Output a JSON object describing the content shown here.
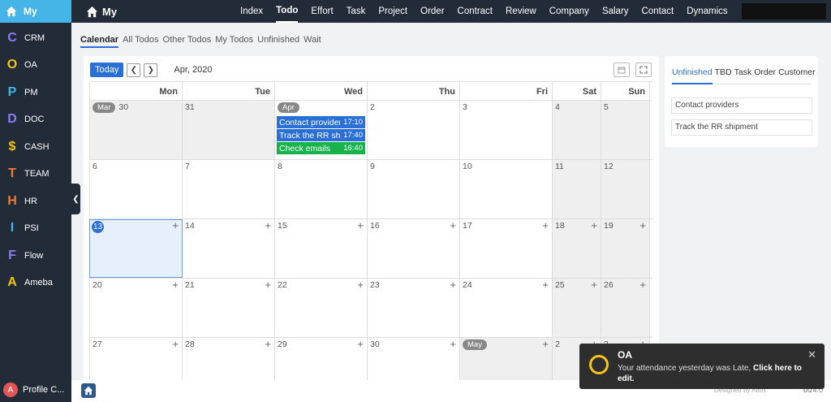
{
  "sidebar": {
    "home_label": "My",
    "items": [
      {
        "letter": "C",
        "label": "CRM",
        "color": "#8b7cf6"
      },
      {
        "letter": "O",
        "label": "OA",
        "color": "#f5c518"
      },
      {
        "letter": "P",
        "label": "PM",
        "color": "#45b5e8"
      },
      {
        "letter": "D",
        "label": "DOC",
        "color": "#8b7cf6"
      },
      {
        "letter": "$",
        "label": "CASH",
        "color": "#f5c518"
      },
      {
        "letter": "T",
        "label": "TEAM",
        "color": "#f07a3a"
      },
      {
        "letter": "H",
        "label": "HR",
        "color": "#f07a3a"
      },
      {
        "letter": "I",
        "label": "PSI",
        "color": "#45b5e8"
      },
      {
        "letter": "F",
        "label": "Flow",
        "color": "#8b7cf6"
      },
      {
        "letter": "A",
        "label": "Ameba",
        "color": "#f5c518"
      }
    ],
    "profile_initial": "A",
    "profile_label": "Profile C..."
  },
  "topbar": {
    "brand": "My",
    "nav": [
      "Index",
      "Todo",
      "Effort",
      "Task",
      "Project",
      "Order",
      "Contract",
      "Review",
      "Company",
      "Salary",
      "Contact",
      "Dynamics"
    ],
    "active": "Todo"
  },
  "subtabs": [
    "Calendar",
    "All Todos",
    "Other Todos",
    "My Todos",
    "Unfinished",
    "Wait"
  ],
  "calendar": {
    "today_label": "Today",
    "title": "Apr, 2020",
    "weekdays": [
      "Mon",
      "Tue",
      "Wed",
      "Thu",
      "Fri",
      "Sat",
      "Sun"
    ],
    "month_labels": {
      "mar": "Mar",
      "apr": "Apr",
      "may": "May"
    },
    "events": [
      {
        "name": "Contact providers",
        "time": "17:10",
        "color": "#2a6fd6"
      },
      {
        "name": "Track the RR shipn",
        "time": "17:40",
        "color": "#2a6fd6"
      },
      {
        "name": "Check emails",
        "time": "16:40",
        "color": "#17b24b"
      }
    ],
    "weeks": [
      [
        "30",
        "31",
        "",
        "2",
        "3",
        "4",
        "5"
      ],
      [
        "6",
        "7",
        "8",
        "9",
        "10",
        "11",
        "12"
      ],
      [
        "13",
        "14",
        "15",
        "16",
        "17",
        "18",
        "19"
      ],
      [
        "20",
        "21",
        "22",
        "23",
        "24",
        "25",
        "26"
      ],
      [
        "27",
        "28",
        "29",
        "30",
        "",
        "2",
        "3"
      ]
    ]
  },
  "rightpanel": {
    "tabs": [
      "Unfinished",
      "TBD",
      "Task",
      "Order",
      "Customer"
    ],
    "items": [
      "Contact providers",
      "Track the RR shipment"
    ]
  },
  "footer": {
    "credit": "Designed by Atlox",
    "version": "biz4.0"
  },
  "toast": {
    "title": "OA",
    "message": "Your attendance yesterday was Late,",
    "link": "Click here to edit.",
    "close": "✕"
  }
}
